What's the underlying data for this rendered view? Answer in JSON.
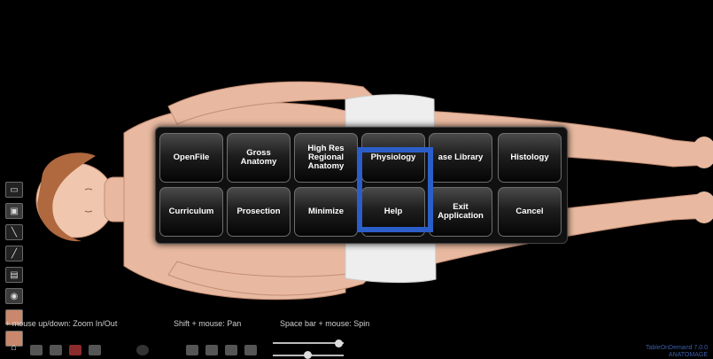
{
  "menu": {
    "row1": [
      "OpenFile",
      "Gross Anatomy",
      "High Res Regional Anatomy",
      "Physiology",
      "Case Library",
      "Histology"
    ],
    "row1_display": [
      "OpenFile",
      "Gross Anatomy",
      [
        "High Res",
        "Regional",
        "Anatomy"
      ],
      "Physiology",
      "ase Library",
      "Histology"
    ],
    "row2": [
      "Curriculum",
      "Prosection",
      "Minimize",
      "Help",
      "Exit Application",
      "Cancel"
    ],
    "row2_display": [
      "Curriculum",
      "Prosection",
      "Minimize",
      "Help",
      [
        "Exit",
        "Application"
      ],
      "Cancel"
    ],
    "highlighted": "Help",
    "highlight_color": "#2c5ec9"
  },
  "hints": {
    "zoom": "+ mouse up/down: Zoom In/Out",
    "pan": "Shift + mouse: Pan",
    "spin": "Space bar + mouse: Spin"
  },
  "left_toolbar_icons": [
    "panel-icon",
    "camera-icon",
    "line-icon",
    "slash-icon",
    "measure-icon",
    "eye-icon",
    "hand-icon",
    "pointer-icon"
  ],
  "bottom_toolbar_icons": [
    "home-icon",
    "pen-icon",
    "pen-red-icon",
    "brush-icon",
    "circle-icon",
    "layers-icon",
    "grid-icon",
    "copy-icon",
    "eye-icon"
  ],
  "watermark": [
    "TableOnDemand 7.0.0",
    "ANATOMAGE"
  ]
}
